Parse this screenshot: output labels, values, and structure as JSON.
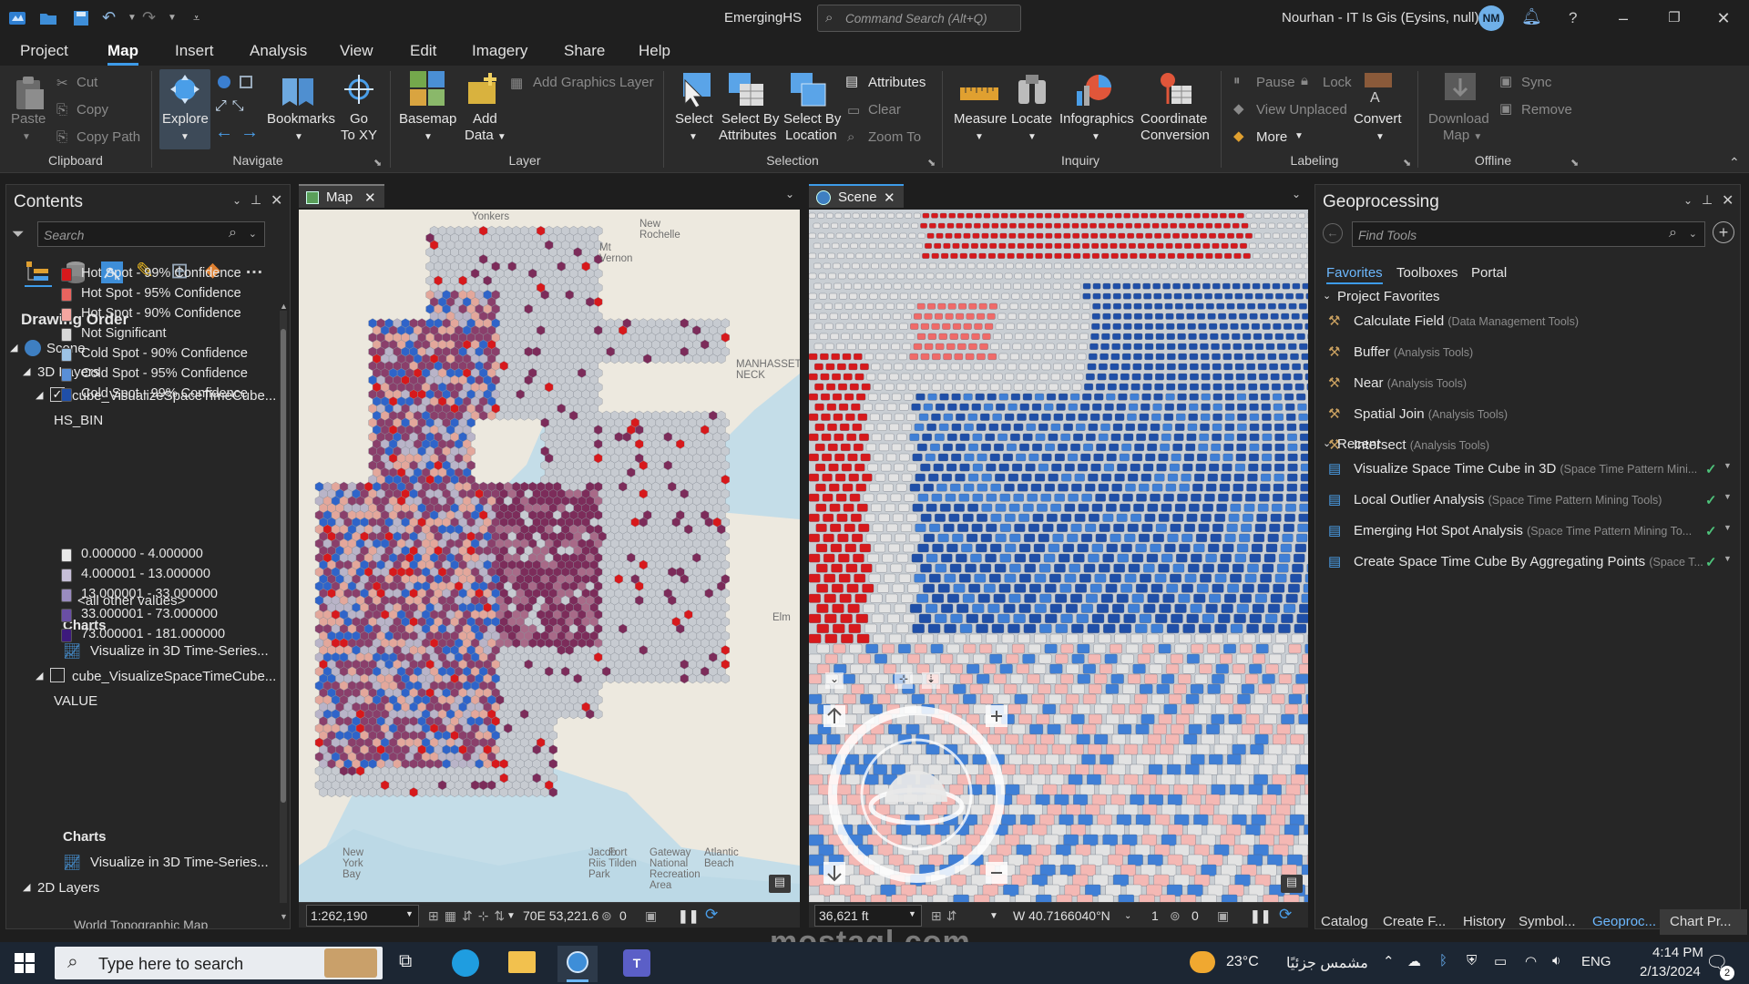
{
  "title_bar": {
    "app_title": "EmergingHS",
    "command_search_placeholder": "Command Search (Alt+Q)",
    "user": "Nourhan - IT Is Gis (Eysins, null)",
    "user_initials": "NM"
  },
  "menu": {
    "tabs": [
      "Project",
      "Map",
      "Insert",
      "Analysis",
      "View",
      "Edit",
      "Imagery",
      "Share",
      "Help"
    ],
    "active": "Map"
  },
  "ribbon": {
    "clipboard": {
      "paste": "Paste",
      "cut": "Cut",
      "copy": "Copy",
      "copy_path": "Copy Path",
      "group": "Clipboard"
    },
    "navigate": {
      "explore": "Explore",
      "bookmarks": "Bookmarks",
      "go_to_xy_1": "Go",
      "go_to_xy_2": "To XY",
      "group": "Navigate"
    },
    "layer": {
      "basemap": "Basemap",
      "add_data_1": "Add",
      "add_data_2": "Data",
      "add_graphics_layer": "Add Graphics Layer",
      "group": "Layer"
    },
    "selection": {
      "select": "Select",
      "by_attr_1": "Select By",
      "by_attr_2": "Attributes",
      "by_loc_1": "Select By",
      "by_loc_2": "Location",
      "attributes": "Attributes",
      "clear": "Clear",
      "zoom_to": "Zoom To",
      "group": "Selection"
    },
    "inquiry": {
      "measure": "Measure",
      "locate": "Locate",
      "infographics": "Infographics",
      "coord_1": "Coordinate",
      "coord_2": "Conversion",
      "group": "Inquiry"
    },
    "labeling": {
      "pause": "Pause",
      "lock": "Lock",
      "view_unplaced": "View Unplaced",
      "more": "More",
      "convert": "Convert",
      "group": "Labeling"
    },
    "offline": {
      "download_1": "Download",
      "download_2": "Map",
      "sync": "Sync",
      "remove": "Remove",
      "group": "Offline"
    }
  },
  "contents": {
    "title": "Contents",
    "search_placeholder": "Search",
    "drawing_order": "Drawing Order",
    "scene": "Scene",
    "layers_3d": "3D Layers",
    "layer1": {
      "name": "cube_VisualizeSpaceTimeCube...",
      "field": "HS_BIN",
      "classes": [
        {
          "label": "Hot Spot - 99% Confidence",
          "color": "#d7191c"
        },
        {
          "label": "Hot Spot - 95% Confidence",
          "color": "#e9645f"
        },
        {
          "label": "Hot Spot - 90% Confidence",
          "color": "#f4a6a0"
        },
        {
          "label": "Not Significant",
          "color": "#d9d9d9"
        },
        {
          "label": "Cold Spot - 90% Confidence",
          "color": "#9dc3e6"
        },
        {
          "label": "Cold Spot - 95% Confidence",
          "color": "#5a8fd6"
        },
        {
          "label": "Cold Spot - 99% Confidence",
          "color": "#1f4fa8"
        }
      ],
      "other": "<all other values>",
      "charts": "Charts",
      "chart_item": "Visualize in 3D Time-Series..."
    },
    "layer2": {
      "name": "cube_VisualizeSpaceTimeCube...",
      "field": "VALUE",
      "classes": [
        {
          "label": "0.000000 - 4.000000",
          "color": "#e9e9e9"
        },
        {
          "label": "4.000001 - 13.000000",
          "color": "#c7bfd8"
        },
        {
          "label": "13.000001 - 33.000000",
          "color": "#9a8cc0"
        },
        {
          "label": "33.000001 - 73.000000",
          "color": "#6a4fa5"
        },
        {
          "label": "73.000001 - 181.000000",
          "color": "#3d1a7d"
        }
      ],
      "charts": "Charts",
      "chart_item": "Visualize in 3D Time-Series..."
    },
    "layers_2d": "2D Layers",
    "basemap_layer": "World Topographic Map"
  },
  "map_view": {
    "tab": "Map",
    "scale": "1:262,190",
    "coords": "70E 53,221.6",
    "sel_count": "0",
    "labels": [
      "Yonkers",
      "New Rochelle",
      "Mt Vernon",
      "MANHASSET NECK",
      "Elm",
      "Gateway National Recreation Area",
      "Atlantic Beach",
      "Fort Tilden",
      "New York Bay",
      "Jacob Riis Park"
    ]
  },
  "scene_view": {
    "tab": "Scene",
    "scale": "36,621 ft",
    "coords": "W 40.7166040°N",
    "count1": "1",
    "count2": "0"
  },
  "geoprocessing": {
    "title": "Geoprocessing",
    "search_placeholder": "Find Tools",
    "tabs": [
      "Favorites",
      "Toolboxes",
      "Portal"
    ],
    "project_favorites": "Project Favorites",
    "favorites": [
      {
        "name": "Calculate Field",
        "box": "(Data Management Tools)"
      },
      {
        "name": "Buffer",
        "box": "(Analysis Tools)"
      },
      {
        "name": "Near",
        "box": "(Analysis Tools)"
      },
      {
        "name": "Spatial Join",
        "box": "(Analysis Tools)"
      },
      {
        "name": "Intersect",
        "box": "(Analysis Tools)"
      }
    ],
    "recent_label": "Recent",
    "recent": [
      {
        "name": "Visualize Space Time Cube in 3D",
        "box": "(Space Time Pattern Mini..."
      },
      {
        "name": "Local Outlier Analysis",
        "box": "(Space Time Pattern Mining Tools)"
      },
      {
        "name": "Emerging Hot Spot Analysis",
        "box": "(Space Time Pattern Mining To..."
      },
      {
        "name": "Create Space Time Cube By Aggregating Points",
        "box": "(Space T..."
      }
    ]
  },
  "bottom_tabs": [
    "Catalog",
    "Create F...",
    "History",
    "Symbol...",
    "Geoproc...",
    "Chart Pr..."
  ],
  "taskbar": {
    "search_placeholder": "Type here to search",
    "weather_temp": "23°C",
    "weather_desc": "مشمس جزئيًا",
    "language": "ENG",
    "time": "4:14 PM",
    "date": "2/13/2024",
    "notifications": "2"
  },
  "watermark": "mostaql.com"
}
